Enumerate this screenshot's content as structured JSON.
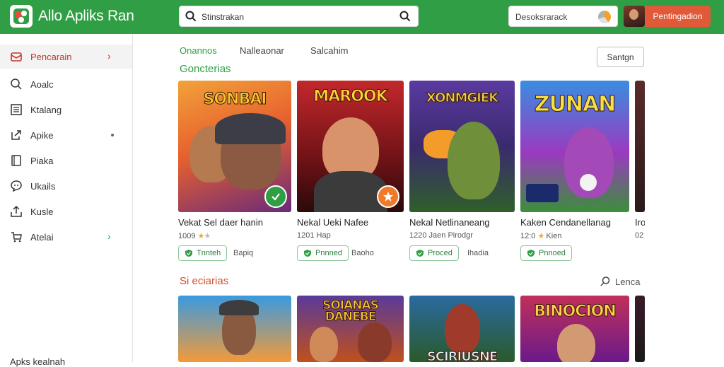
{
  "header": {
    "app_title": "Allo Apliks Ran",
    "search_text": "Stinstrakan",
    "field_text": "Desoksrarack",
    "login_label": "Pentingadion",
    "accent": "#2f9e44"
  },
  "sidebar": {
    "items": [
      {
        "label": "Pencarain",
        "icon": "package-icon",
        "active": true,
        "trail": "chevron"
      },
      {
        "label": "Aoalc",
        "icon": "search-icon",
        "trail": ""
      },
      {
        "label": "Ktalang",
        "icon": "list-icon",
        "trail": ""
      },
      {
        "label": "Apike",
        "icon": "share-icon",
        "trail": "dot"
      },
      {
        "label": "Piaka",
        "icon": "book-icon",
        "trail": ""
      },
      {
        "label": "Ukails",
        "icon": "chat-icon",
        "trail": ""
      },
      {
        "label": "Kusle",
        "icon": "upload-icon",
        "trail": ""
      },
      {
        "label": "Atelai",
        "icon": "cart-icon",
        "trail": "chevron-green"
      }
    ],
    "bottom_label": "Apks kealnah"
  },
  "tabs": [
    {
      "label": "Onannos",
      "active": true
    },
    {
      "label": "Nalleaonar",
      "active": false
    },
    {
      "label": "Salcahim",
      "active": false
    }
  ],
  "sort_label": "Santgn",
  "sections": {
    "first_title": "Goncterias",
    "second_title": "Si eciarias",
    "second_more": "Lenca"
  },
  "cards": [
    {
      "art_title": "SONBAI",
      "name": "Vekat Sel daer hanin",
      "count": "1009",
      "stars": 1,
      "tag": "Tnnteh",
      "extra": "Bapiq"
    },
    {
      "art_title": "MAROOK",
      "name": "Nekal Ueki Nafee",
      "count": "1201",
      "stars": 0,
      "tag": "Pnnned",
      "extra": "Baoho"
    },
    {
      "art_title": "XONMGIEK",
      "name": "Nekal Netlinaneang",
      "count": "1220",
      "stars": 0,
      "tag": "Proced",
      "extra": "Ihadia"
    },
    {
      "art_title": "ZUNAN",
      "name": "Kaken Cendanellanag",
      "count": "12:0",
      "stars": 1,
      "tag": "Pnnoed",
      "extra": ""
    }
  ],
  "card_count_suffixes": [
    "",
    "Hap",
    "Jaen Pirodgr",
    "Kien"
  ],
  "card_edge": {
    "name": "Iro",
    "count": "02"
  },
  "second_row_titles": [
    "",
    "SOIANAS DANEBE",
    "SCIRIUSNE",
    "BINOCION"
  ]
}
